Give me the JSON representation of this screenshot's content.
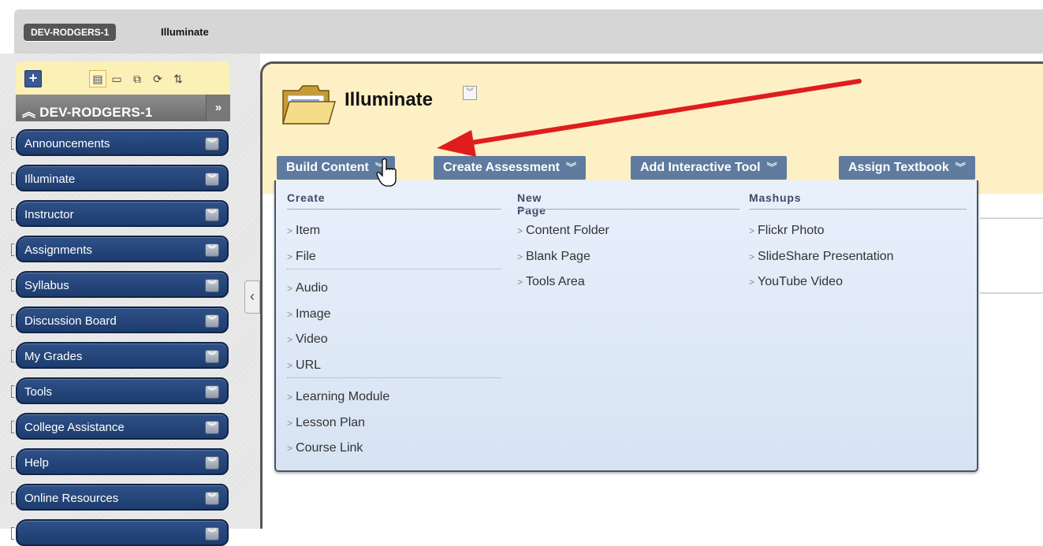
{
  "breadcrumb": {
    "course": "DEV-RODGERS-1",
    "current": "Illuminate"
  },
  "course_menu": {
    "course_name": "DEV-RODGERS-1",
    "collapse_symbol": "»",
    "add_symbol": "+",
    "items": [
      {
        "label": "Announcements"
      },
      {
        "label": "Illuminate"
      },
      {
        "label": "Instructor"
      },
      {
        "label": "Assignments"
      },
      {
        "label": "Syllabus"
      },
      {
        "label": "Discussion Board"
      },
      {
        "label": "My Grades"
      },
      {
        "label": "Tools"
      },
      {
        "label": "College Assistance"
      },
      {
        "label": "Help"
      },
      {
        "label": "Online Resources"
      },
      {
        "label": ""
      }
    ],
    "toolbar_icons": [
      "list-view-icon",
      "folder-view-icon",
      "window-view-icon",
      "refresh-icon",
      "sort-icon"
    ]
  },
  "content": {
    "title": "Illuminate",
    "actions": {
      "build": "Build Content",
      "assessment": "Create Assessment",
      "interactive": "Add Interactive Tool",
      "textbook": "Assign Textbook"
    }
  },
  "dropdown": {
    "columns": [
      {
        "heading": "Create",
        "groups": [
          [
            "Item",
            "File"
          ],
          [
            "Audio",
            "Image",
            "Video",
            "URL"
          ],
          [
            "Learning Module",
            "Lesson Plan",
            "Course Link"
          ]
        ]
      },
      {
        "heading": "New Page",
        "groups": [
          [
            "Content Folder",
            "Blank Page",
            "Tools Area"
          ]
        ]
      },
      {
        "heading": "Mashups",
        "groups": [
          [
            "Flickr Photo",
            "SlideShare Presentation",
            "YouTube Video"
          ]
        ]
      }
    ]
  },
  "colors": {
    "menu_item_bg": "#1d3c6e",
    "header_bg": "#fdf0c4",
    "action_button": "#5f7b9f",
    "annotation_arrow": "#e01d1d"
  }
}
